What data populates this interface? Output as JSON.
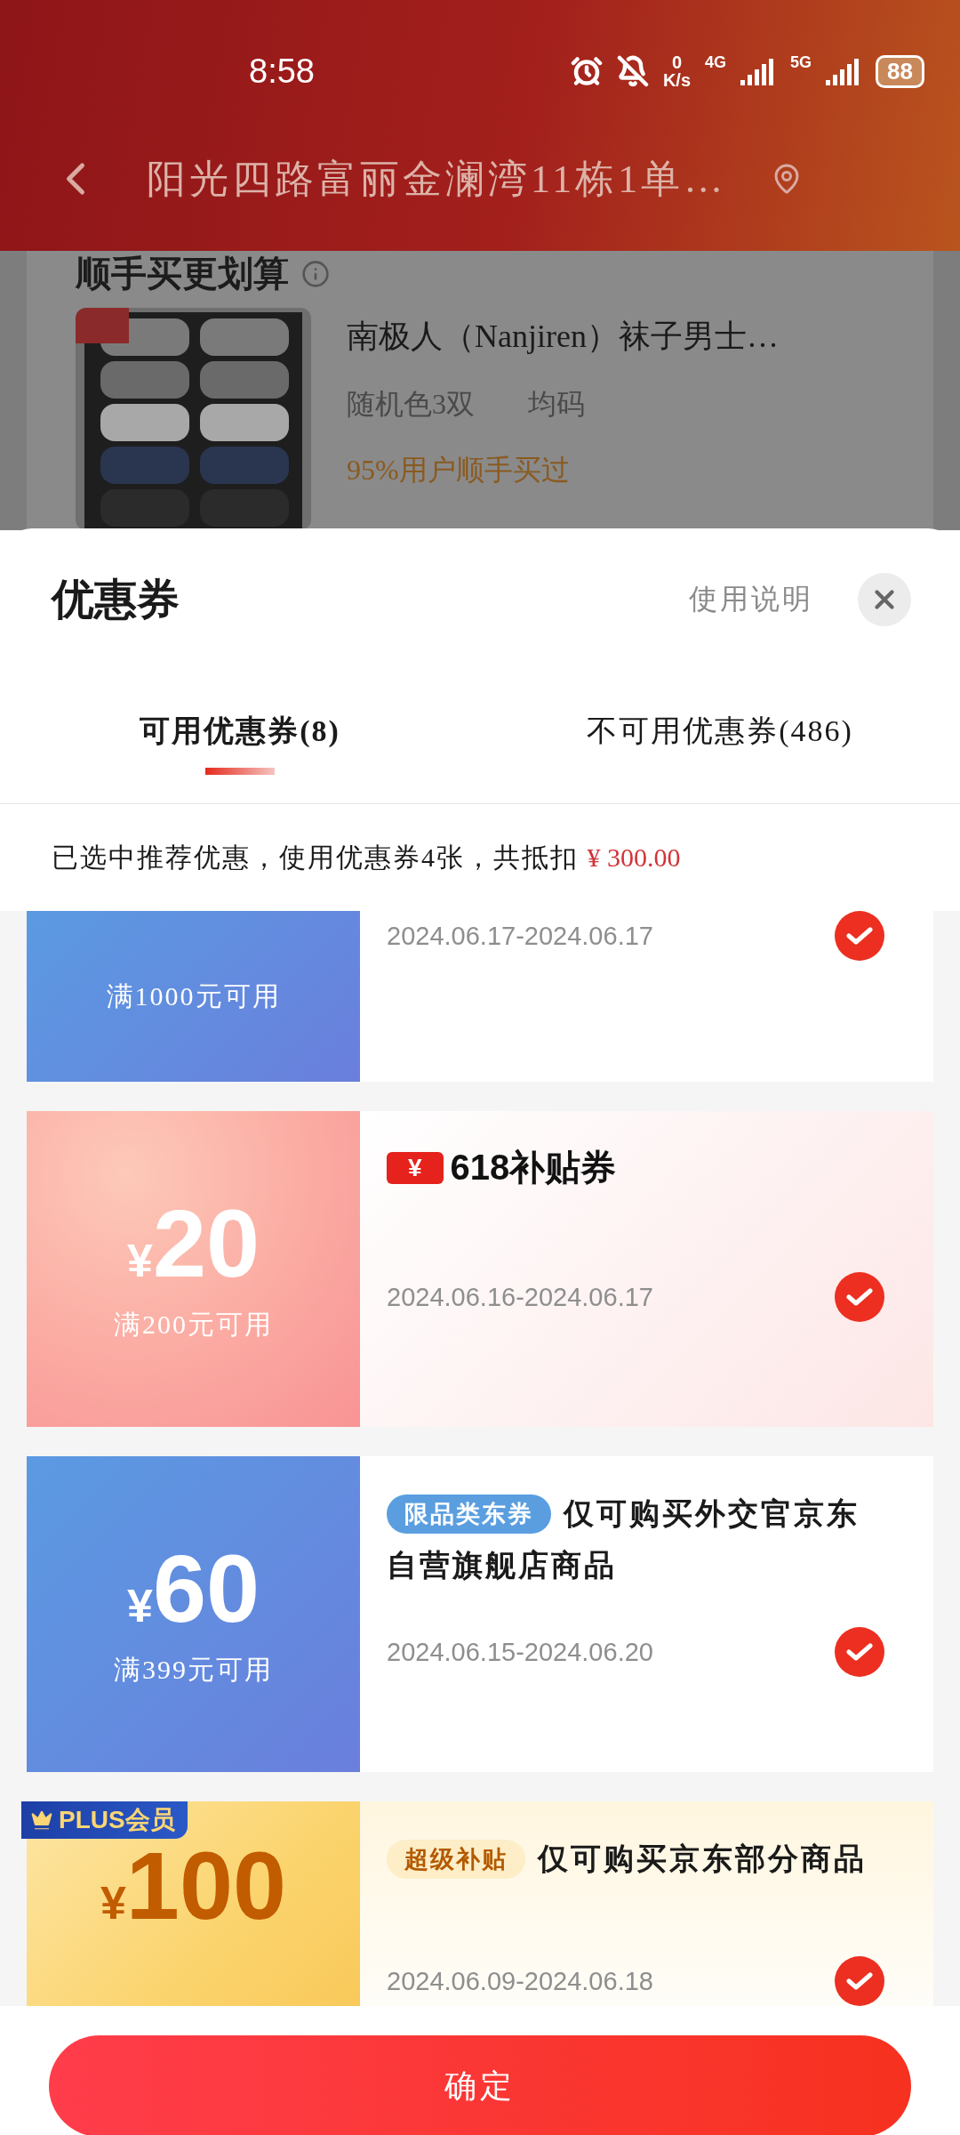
{
  "status_bar": {
    "time": "8:58",
    "speed_value": "0",
    "speed_unit": "K/s",
    "network_1": "4G",
    "network_2": "5G",
    "battery": "88"
  },
  "nav": {
    "address": "阳光四路富丽金澜湾11栋1单…"
  },
  "background_card": {
    "section_title": "顺手买更划算",
    "product": {
      "kind": "picture",
      "title": "南极人（Nanjiren）袜子男士…",
      "spec": "随机色3双",
      "size": "均码",
      "note": "95%用户顺手买过"
    }
  },
  "sheet": {
    "title": "优惠券",
    "help_link": "使用说明",
    "tabs": [
      {
        "label": "可用优惠券(8)",
        "selected": true
      },
      {
        "label": "不可用优惠券(486)",
        "selected": false
      }
    ],
    "summary": "已选中推荐优惠，使用优惠券4张，共抵扣",
    "summary_amount": "¥ 300.00"
  },
  "coupons": [
    {
      "kind": "blue",
      "condition": "满1000元可用",
      "date": "2024.06.17-2024.06.17",
      "checked": true
    },
    {
      "kind": "pink",
      "ticket_label": "¥",
      "title": "618补贴券",
      "currency": "¥",
      "amount": "20",
      "condition": "满200元可用",
      "date": "2024.06.16-2024.06.17",
      "checked": true
    },
    {
      "kind": "blue",
      "tag": {
        "text": "限品类东券",
        "kind": "blue"
      },
      "title": "仅可购买外交官京东",
      "title_continued": "自营旗舰店商品",
      "currency": "¥",
      "amount": "60",
      "condition": "满399元可用",
      "date": "2024.06.15-2024.06.20",
      "checked": true
    },
    {
      "kind": "gold",
      "member_badge": "PLUS会员",
      "tag": {
        "text": "超级补贴",
        "kind": "gold"
      },
      "title": "仅可购买京东部分商品",
      "currency": "¥",
      "amount": "100",
      "date": "2024.06.09-2024.06.18",
      "checked": true
    }
  ],
  "confirm_button": "确定"
}
